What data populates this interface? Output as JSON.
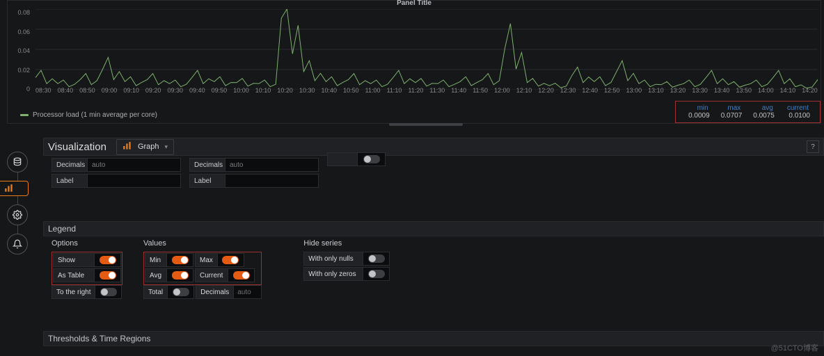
{
  "chart": {
    "title": "Panel Title",
    "series_name": "Processor load (1 min average per core)",
    "series_color": "#7eb26d",
    "y_ticks": [
      "0.08",
      "0.06",
      "0.04",
      "0.02",
      "0"
    ],
    "x_ticks": [
      "08:30",
      "08:40",
      "08:50",
      "09:00",
      "09:10",
      "09:20",
      "09:30",
      "09:40",
      "09:50",
      "10:00",
      "10:10",
      "10:20",
      "10:30",
      "10:40",
      "10:50",
      "11:00",
      "11:10",
      "11:20",
      "11:30",
      "11:40",
      "11:50",
      "12:00",
      "12:10",
      "12:20",
      "12:30",
      "12:40",
      "12:50",
      "13:00",
      "13:10",
      "13:20",
      "13:30",
      "13:40",
      "13:50",
      "14:00",
      "14:10",
      "14:20"
    ],
    "stats": {
      "min_label": "min",
      "min_val": "0.0009",
      "max_label": "max",
      "max_val": "0.0707",
      "avg_label": "avg",
      "avg_val": "0.0075",
      "cur_label": "current",
      "cur_val": "0.0100"
    }
  },
  "chart_data": {
    "type": "line",
    "title": "Panel Title",
    "xlabel": "",
    "ylabel": "",
    "ylim": [
      0,
      0.08
    ],
    "x": [
      "08:30",
      "08:40",
      "08:50",
      "09:00",
      "09:10",
      "09:20",
      "09:30",
      "09:40",
      "09:50",
      "10:00",
      "10:10",
      "10:20",
      "10:30",
      "10:40",
      "10:50",
      "11:00",
      "11:10",
      "11:20",
      "11:30",
      "11:40",
      "11:50",
      "12:00",
      "12:10",
      "12:20",
      "12:30",
      "12:40",
      "12:50",
      "13:00",
      "13:10",
      "13:20",
      "13:30",
      "13:40",
      "13:50",
      "14:00",
      "14:10",
      "14:20"
    ],
    "series": [
      {
        "name": "Processor load (1 min average per core)",
        "color": "#7eb26d",
        "values": [
          0.012,
          0.006,
          0.01,
          0.02,
          0.008,
          0.01,
          0.006,
          0.012,
          0.008,
          0.007,
          0.006,
          0.071,
          0.018,
          0.008,
          0.01,
          0.006,
          0.012,
          0.007,
          0.006,
          0.008,
          0.01,
          0.041,
          0.007,
          0.004,
          0.014,
          0.008,
          0.018,
          0.006,
          0.005,
          0.006,
          0.012,
          0.005,
          0.006,
          0.012,
          0.003,
          0.01
        ]
      }
    ],
    "stats": {
      "min": 0.0009,
      "max": 0.0707,
      "avg": 0.0075,
      "current": 0.01
    }
  },
  "viz": {
    "title": "Visualization",
    "dropdown": "Graph",
    "help": "?"
  },
  "axes": {
    "left": {
      "decimals_label": "Decimals",
      "decimals_placeholder": "auto",
      "label_label": "Label"
    },
    "right": {
      "decimals_label": "Decimals",
      "decimals_placeholder": "auto",
      "label_label": "Label"
    },
    "extra": {
      "label": ""
    }
  },
  "legend": {
    "header": "Legend",
    "options": {
      "title": "Options",
      "show": "Show",
      "as_table": "As Table",
      "to_right": "To the right"
    },
    "values": {
      "title": "Values",
      "min": "Min",
      "max": "Max",
      "avg": "Avg",
      "current": "Current",
      "total": "Total",
      "decimals": "Decimals",
      "decimals_placeholder": "auto"
    },
    "hide": {
      "title": "Hide series",
      "nulls": "With only nulls",
      "zeros": "With only zeros"
    }
  },
  "thresholds": {
    "header": "Thresholds & Time Regions"
  },
  "watermark": "@51CTO博客"
}
